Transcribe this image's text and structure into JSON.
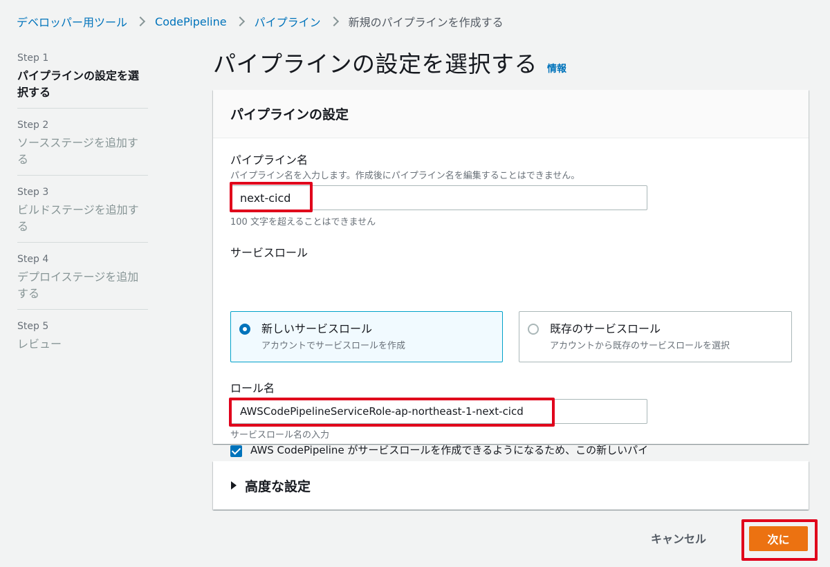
{
  "breadcrumb": {
    "items": [
      "デベロッパー用ツール",
      "CodePipeline",
      "パイプライン"
    ],
    "current": "新規のパイプラインを作成する"
  },
  "steps": [
    {
      "num": "Step 1",
      "title": "パイプラインの設定を選択する",
      "active": true
    },
    {
      "num": "Step 2",
      "title": "ソースステージを追加する",
      "active": false
    },
    {
      "num": "Step 3",
      "title": "ビルドステージを追加する",
      "active": false
    },
    {
      "num": "Step 4",
      "title": "デプロイステージを追加する",
      "active": false
    },
    {
      "num": "Step 5",
      "title": "レビュー",
      "active": false
    }
  ],
  "page": {
    "title": "パイプラインの設定を選択する",
    "info_link": "情報"
  },
  "settings": {
    "header": "パイプラインの設定",
    "pipeline_name": {
      "label": "パイプライン名",
      "description": "パイプライン名を入力します。作成後にパイプライン名を編集することはできません。",
      "value": "next-cicd",
      "constraint": "100 文字を超えることはできません"
    },
    "service_role": {
      "label": "サービスロール",
      "options": [
        {
          "title": "新しいサービスロール",
          "desc": "アカウントでサービスロールを作成",
          "selected": true
        },
        {
          "title": "既存のサービスロール",
          "desc": "アカウントから既存のサービスロールを選択",
          "selected": false
        }
      ]
    },
    "role_name": {
      "label": "ロール名",
      "value": "AWSCodePipelineServiceRole-ap-northeast-1-next-cicd",
      "description": "サービスロール名の入力"
    },
    "allow_checkbox": {
      "checked": true,
      "text": "AWS CodePipeline がサービスロールを作成できるようになるため、この新しいパイプラインでの使用が可能になります。"
    }
  },
  "advanced": {
    "label": "高度な設定"
  },
  "footer": {
    "cancel": "キャンセル",
    "next": "次に"
  },
  "colors": {
    "accent": "#0073bb",
    "primary_button": "#ec7211",
    "highlight": "#e0001b"
  }
}
